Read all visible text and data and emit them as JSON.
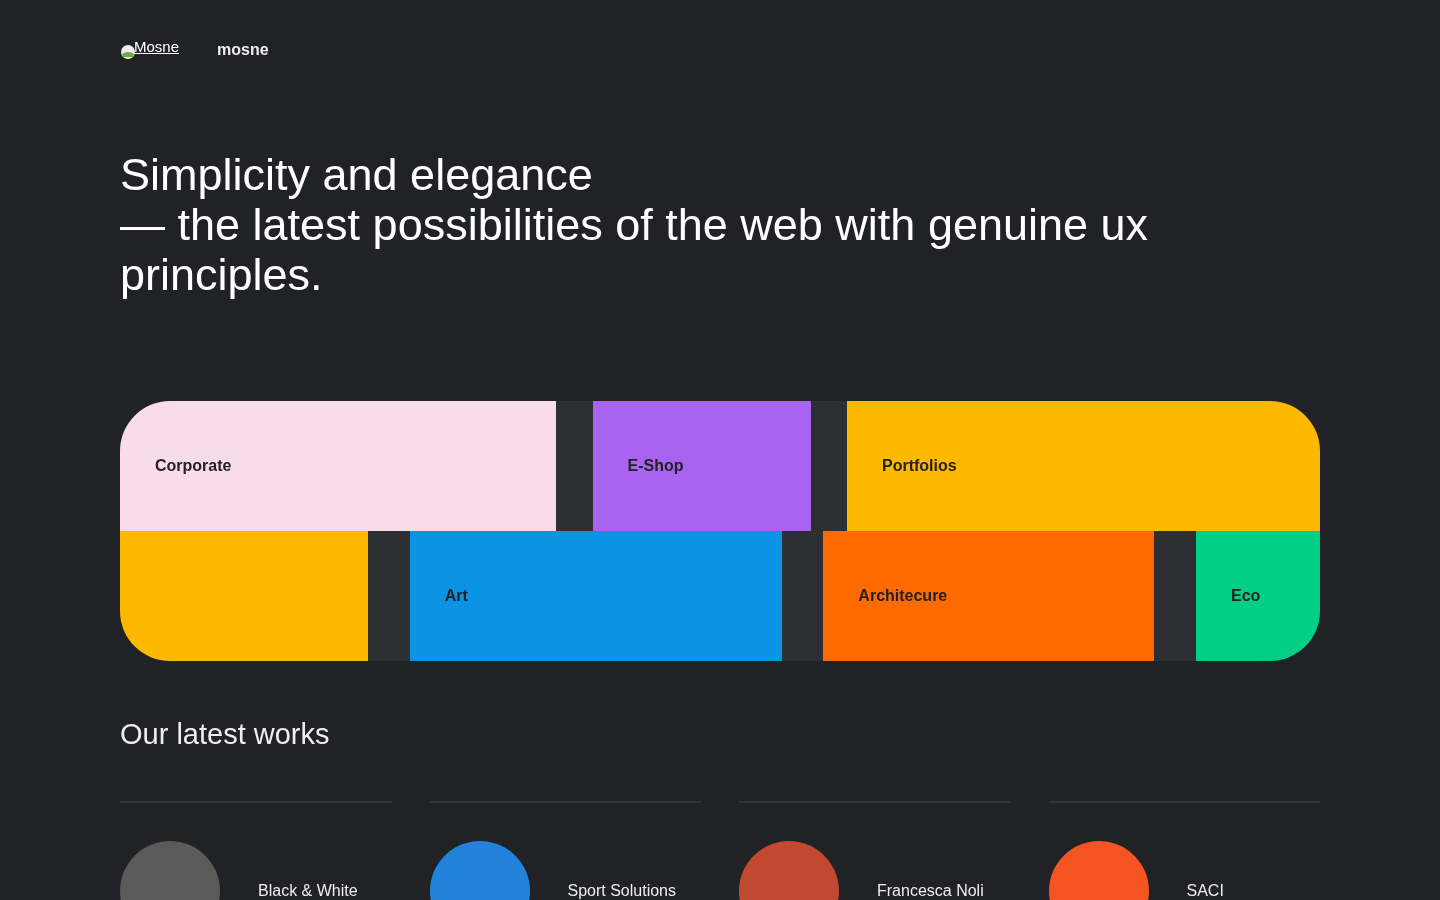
{
  "header": {
    "logo_alt": "Mosne",
    "site_name": "mosne"
  },
  "hero": {
    "line_1": "Simplicity and elegance",
    "line_2": "— the latest possibilities of the web with genuine ux principles."
  },
  "tiles": [
    [
      {
        "label": "Corporate",
        "color": "#f9dcea"
      },
      {
        "label": "E-Shop",
        "color": "#a864f0"
      },
      {
        "label": "Portfolios",
        "color": "#fdb900"
      }
    ],
    [
      {
        "color": "#fdb900"
      },
      {
        "label": "Art",
        "color": "#0a94e3"
      },
      {
        "label": "Architecure",
        "color": "#ff6b00"
      },
      {
        "label": "Eco",
        "color": "#00cf86"
      }
    ]
  ],
  "works": {
    "title": "Our latest works",
    "items": [
      {
        "name": "Black & White",
        "color": "#5a5a5a"
      },
      {
        "name": "Sport Solutions",
        "color": "#2382d9"
      },
      {
        "name": "Francesca Noli",
        "color": "#c0492f"
      },
      {
        "name": "SACI",
        "color": "#f35422"
      }
    ]
  }
}
